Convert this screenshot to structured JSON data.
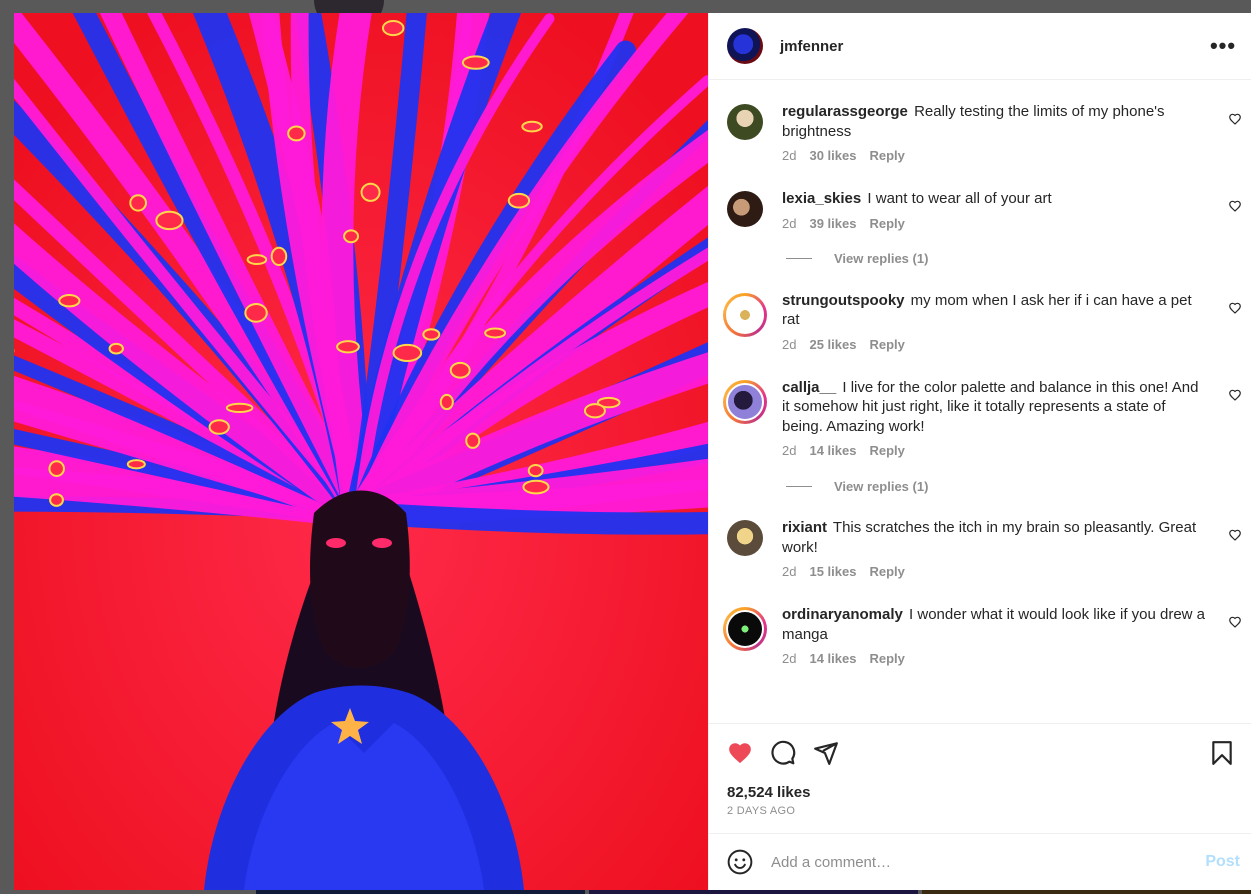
{
  "post": {
    "owner": "jmfenner",
    "more_icon": "more-horizontal-icon",
    "likes": "82,524 likes",
    "timestamp": "2 DAYS AGO",
    "liked": true,
    "accent": "#ed4956"
  },
  "comments": [
    {
      "user": "regularassgeorge",
      "text": "Really testing the limits of my phone's brightness",
      "time": "2d",
      "likes": "30 likes",
      "reply": "Reply",
      "ring": false
    },
    {
      "user": "lexia_skies",
      "text": "I want to wear all of your art",
      "time": "2d",
      "likes": "39 likes",
      "reply": "Reply",
      "ring": false,
      "view_replies": "View replies (1)"
    },
    {
      "user": "strungoutspooky",
      "text": "my mom when I ask her if i can have a pet rat",
      "time": "2d",
      "likes": "25 likes",
      "reply": "Reply",
      "ring": true
    },
    {
      "user": "callja__",
      "text": "I live for the color palette and balance in this one! And it somehow hit just right, like it totally represents a state of being. Amazing work!",
      "time": "2d",
      "likes": "14 likes",
      "reply": "Reply",
      "ring": true,
      "view_replies": "View replies (1)"
    },
    {
      "user": "rixiant",
      "text": "This scratches the itch in my brain so pleasantly. Great work!",
      "time": "2d",
      "likes": "15 likes",
      "reply": "Reply",
      "ring": false
    },
    {
      "user": "ordinaryanomaly",
      "text": "I wonder what it would look like if you drew a manga",
      "time": "2d",
      "likes": "14 likes",
      "reply": "Reply",
      "ring": true
    }
  ],
  "composer": {
    "placeholder": "Add a comment…",
    "post_label": "Post",
    "emoji_icon": "emoji-icon"
  },
  "icons": {
    "like": "heart-icon",
    "comment": "comment-icon",
    "share": "send-icon",
    "save": "bookmark-icon"
  }
}
